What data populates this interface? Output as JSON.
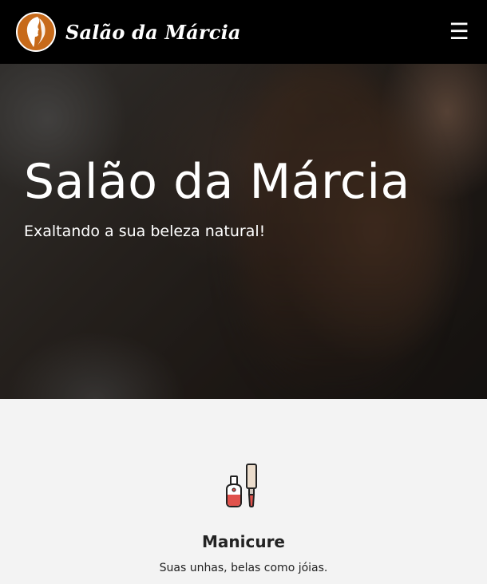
{
  "navbar": {
    "brand_name": "Salão da Márcia",
    "logo_icon": "woman-silhouette-icon",
    "menu_icon": "hamburger-menu-icon",
    "menu_glyph": "☰"
  },
  "hero": {
    "title": "Salão da Márcia",
    "subtitle": "Exaltando a sua beleza natural!"
  },
  "services": {
    "items": [
      {
        "icon": "nail-polish-icon",
        "title": "Manicure",
        "description": "Suas unhas, belas como jóias."
      }
    ]
  },
  "colors": {
    "navbar_bg": "#000000",
    "logo_accent": "#c76a1a",
    "page_bg": "#f3f3f3",
    "text_dark": "#222222",
    "polish_red": "#e0524c"
  }
}
